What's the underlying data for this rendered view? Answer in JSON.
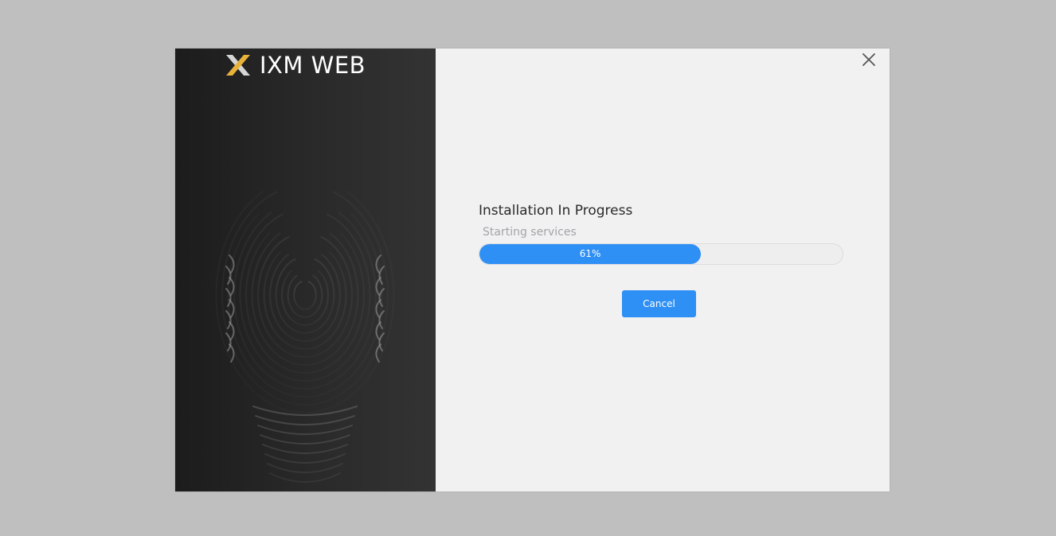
{
  "app": {
    "brand_name": "IXM WEB",
    "logo_icon": "ixm-x-logo-icon",
    "decorative_art": "fingerprint-face-icon"
  },
  "colors": {
    "accent": "#2e8ff5",
    "logo_gold": "#e8b23a",
    "logo_silver": "#d6d6d6",
    "left_panel_bg": "#262626",
    "right_panel_bg": "#f1f1f2"
  },
  "window": {
    "close_icon": "close-icon"
  },
  "progress": {
    "title": "Installation In Progress",
    "status": "Starting services",
    "percent": 61,
    "percent_label": "61%"
  },
  "actions": {
    "cancel_label": "Cancel"
  }
}
